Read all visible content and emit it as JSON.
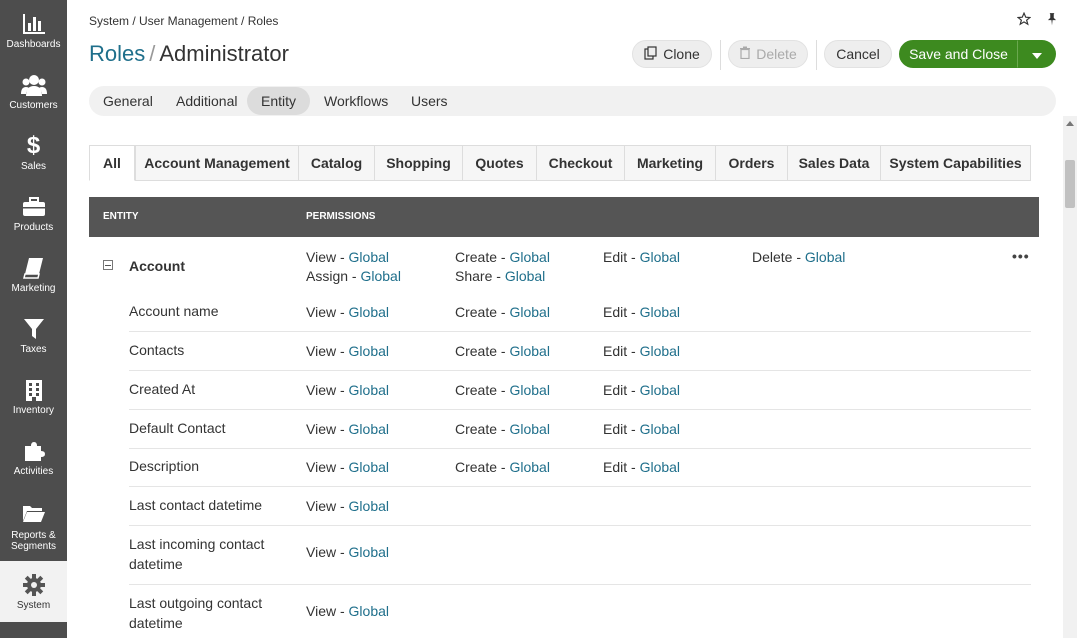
{
  "sidebar": {
    "items": [
      {
        "label": "Dashboards",
        "icon": "bar-chart-icon"
      },
      {
        "label": "Customers",
        "icon": "users-icon"
      },
      {
        "label": "Sales",
        "icon": "dollar-icon"
      },
      {
        "label": "Products",
        "icon": "briefcase-icon"
      },
      {
        "label": "Marketing",
        "icon": "book-icon"
      },
      {
        "label": "Taxes",
        "icon": "filter-icon"
      },
      {
        "label": "Inventory",
        "icon": "building-icon"
      },
      {
        "label": "Activities",
        "icon": "puzzle-icon"
      },
      {
        "label": "Reports &",
        "label2": "Segments",
        "icon": "folder-icon"
      },
      {
        "label": "System",
        "icon": "gear-icon"
      }
    ]
  },
  "breadcrumb": "System / User Management / Roles",
  "title": {
    "part1": "Roles",
    "separator": "/",
    "part2": "Administrator"
  },
  "actions": {
    "clone": "Clone",
    "delete": "Delete",
    "cancel": "Cancel",
    "save_close": "Save and Close"
  },
  "section_tabs": [
    "General",
    "Additional",
    "Entity",
    "Workflows",
    "Users"
  ],
  "category_tabs": [
    "All",
    "Account Management",
    "Catalog",
    "Shopping",
    "Quotes",
    "Checkout",
    "Marketing",
    "Orders",
    "Sales Data",
    "System Capabilities"
  ],
  "table": {
    "header": {
      "entity": "ENTITY",
      "permissions": "PERMISSIONS"
    },
    "group": {
      "name": "Account",
      "permissions": {
        "view": "View",
        "create": "Create",
        "edit": "Edit",
        "delete": "Delete",
        "assign": "Assign",
        "share": "Share",
        "dash": " - ",
        "level": "Global"
      }
    },
    "rows": [
      {
        "name": "Account name",
        "perms": [
          "View",
          "Create",
          "Edit"
        ]
      },
      {
        "name": "Contacts",
        "perms": [
          "View",
          "Create",
          "Edit"
        ]
      },
      {
        "name": "Created At",
        "perms": [
          "View",
          "Create",
          "Edit"
        ]
      },
      {
        "name": "Default Contact",
        "perms": [
          "View",
          "Create",
          "Edit"
        ]
      },
      {
        "name": "Description",
        "perms": [
          "View",
          "Create",
          "Edit"
        ]
      },
      {
        "name": "Last contact datetime",
        "perms": [
          "View"
        ]
      },
      {
        "name": "Last incoming contact datetime",
        "perms": [
          "View"
        ]
      },
      {
        "name": "Last outgoing contact datetime",
        "perms": [
          "View"
        ]
      }
    ]
  }
}
